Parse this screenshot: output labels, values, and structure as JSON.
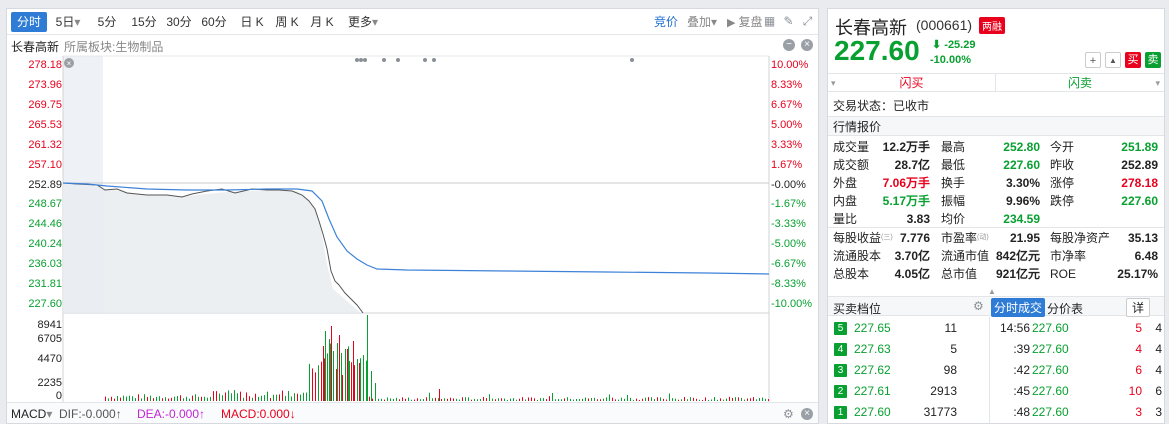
{
  "tabs": [
    {
      "label": "分时",
      "active": true
    },
    {
      "label": "5日"
    },
    {
      "label": "5分"
    },
    {
      "label": "15分"
    },
    {
      "label": "30分"
    },
    {
      "label": "60分"
    },
    {
      "label": "日 K"
    },
    {
      "label": "周 K"
    },
    {
      "label": "月 K"
    },
    {
      "label": "更多"
    }
  ],
  "tab_caret": "▾",
  "toolbar": {
    "auction": "竞价",
    "overlay": "叠加",
    "overlay_caret": "▾",
    "review": "复盘"
  },
  "chart_title": "长春高新",
  "chart_sector": "所属板块:生物制品",
  "price_chart": {
    "left_axis": [
      {
        "v": "278.18",
        "c": "red"
      },
      {
        "v": "273.96",
        "c": "red"
      },
      {
        "v": "269.75",
        "c": "red"
      },
      {
        "v": "265.53",
        "c": "red"
      },
      {
        "v": "261.32",
        "c": "red"
      },
      {
        "v": "257.10",
        "c": "red"
      },
      {
        "v": "252.89",
        "c": "dark"
      },
      {
        "v": "248.67",
        "c": "green"
      },
      {
        "v": "244.46",
        "c": "green"
      },
      {
        "v": "240.24",
        "c": "green"
      },
      {
        "v": "236.03",
        "c": "green"
      },
      {
        "v": "231.81",
        "c": "green"
      },
      {
        "v": "227.60",
        "c": "green"
      }
    ],
    "right_axis": [
      {
        "v": "10.00%",
        "c": "red"
      },
      {
        "v": "8.33%",
        "c": "red"
      },
      {
        "v": "6.67%",
        "c": "red"
      },
      {
        "v": "5.00%",
        "c": "red"
      },
      {
        "v": "3.33%",
        "c": "red"
      },
      {
        "v": "1.67%",
        "c": "red"
      },
      {
        "v": "-0.00%",
        "c": "dark"
      },
      {
        "v": "-1.67%",
        "c": "green"
      },
      {
        "v": "-3.33%",
        "c": "green"
      },
      {
        "v": "-5.00%",
        "c": "green"
      },
      {
        "v": "-6.67%",
        "c": "green"
      },
      {
        "v": "-8.33%",
        "c": "green"
      },
      {
        "v": "-10.00%",
        "c": "green"
      }
    ]
  },
  "volume_axis": [
    "8941",
    "6705",
    "4470",
    "2235",
    "0"
  ],
  "macd": {
    "name": "MACD",
    "caret": "▾",
    "dif": "DIF:-0.000↑",
    "dea": "DEA:-0.000↑",
    "macd": "MACD:0.000↓"
  },
  "stock": {
    "name": "长春高新",
    "code": "(000661)",
    "badge": "两融",
    "price": "227.60",
    "change": "-25.29",
    "change_arrow": "⬇",
    "change_pct": "-10.00%"
  },
  "actions": {
    "add": "+",
    "alert": "▲",
    "buy": "买",
    "sell": "卖"
  },
  "flash": {
    "buy": "闪买",
    "sell": "闪卖"
  },
  "status": {
    "label": "交易状态：",
    "value": "已收市"
  },
  "quote_title": "行情报价",
  "quotes": [
    [
      {
        "k": "成交量",
        "v": "12.2万手",
        "c": "dark"
      },
      {
        "k": "最高",
        "v": "252.80",
        "c": "green"
      },
      {
        "k": "今开",
        "v": "251.89",
        "c": "green"
      }
    ],
    [
      {
        "k": "成交额",
        "v": "28.7亿",
        "c": "dark"
      },
      {
        "k": "最低",
        "v": "227.60",
        "c": "green"
      },
      {
        "k": "昨收",
        "v": "252.89",
        "c": "dark"
      }
    ],
    [
      {
        "k": "外盘",
        "v": "7.06万手",
        "c": "red"
      },
      {
        "k": "换手",
        "v": "3.30%",
        "c": "dark"
      },
      {
        "k": "涨停",
        "v": "278.18",
        "c": "red"
      }
    ],
    [
      {
        "k": "内盘",
        "v": "5.17万手",
        "c": "green"
      },
      {
        "k": "振幅",
        "v": "9.96%",
        "c": "dark"
      },
      {
        "k": "跌停",
        "v": "227.60",
        "c": "green"
      }
    ],
    [
      {
        "k": "量比",
        "v": "3.83",
        "c": "dark"
      },
      {
        "k": "均价",
        "v": "234.59",
        "c": "green"
      }
    ]
  ],
  "fund": [
    [
      {
        "k": "每股收益",
        "sup": "(三)",
        "v": "7.776"
      },
      {
        "k": "市盈率",
        "sup": "(动)",
        "v": "21.95"
      },
      {
        "k": "每股净资产",
        "v": "35.13"
      }
    ],
    [
      {
        "k": "流通股本",
        "v": "3.70亿"
      },
      {
        "k": "流通市值",
        "v": "842亿元"
      },
      {
        "k": "市净率",
        "v": "6.48"
      }
    ],
    [
      {
        "k": "总股本",
        "v": "4.05亿"
      },
      {
        "k": "总市值",
        "v": "921亿元"
      },
      {
        "k": "ROE",
        "v": "25.17%"
      }
    ]
  ],
  "orderbook": {
    "title": "买卖档位",
    "tab_trades": "分时成交",
    "tab_price": "分价表",
    "detail": "详",
    "rows": [
      {
        "n": "5",
        "p": "227.65",
        "q": "11"
      },
      {
        "n": "4",
        "p": "227.63",
        "q": "5"
      },
      {
        "n": "3",
        "p": "227.62",
        "q": "98"
      },
      {
        "n": "2",
        "p": "227.61",
        "q": "2913"
      },
      {
        "n": "1",
        "p": "227.60",
        "q": "31773"
      }
    ]
  },
  "trades": [
    {
      "t": "14:56",
      "p": "227.60",
      "v": "5",
      "c": "4"
    },
    {
      "t": ":39",
      "p": "227.60",
      "v": "4",
      "c": "4"
    },
    {
      "t": ":42",
      "p": "227.60",
      "v": "6",
      "c": "4"
    },
    {
      "t": ":45",
      "p": "227.60",
      "v": "10",
      "c": "6"
    },
    {
      "t": ":48",
      "p": "227.60",
      "v": "3",
      "c": "3"
    }
  ],
  "colors": {
    "up": "#e8001c",
    "down": "#08a030",
    "price_line": "#555555",
    "avg_line": "#3d82d8",
    "accent": "#2e7cd6"
  }
}
